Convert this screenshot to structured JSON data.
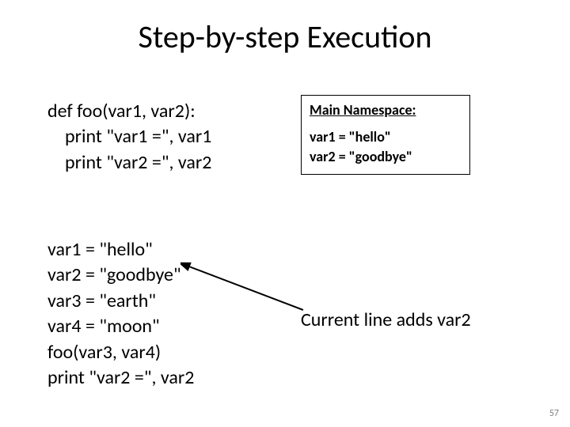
{
  "title": "Step-by-step Execution",
  "code_left": {
    "line1": "def foo(var1, var2):",
    "line2": "print \"var1 =\", var1",
    "line3": "print \"var2 =\", var2"
  },
  "namespace": {
    "heading": "Main Namespace:",
    "line1": "var1 = \"hello\"",
    "line2": "var2 = \"goodbye\""
  },
  "code_bottom": {
    "line1": "var1 = \"hello\"",
    "line2": "var2 = \"goodbye\"",
    "line3": "var3 = \"earth\"",
    "line4": "var4 = \"moon\"",
    "line5": "foo(var3, var4)",
    "line6": "print \"var2 =\", var2"
  },
  "annotation": "Current line adds var2",
  "slide_number": "57"
}
